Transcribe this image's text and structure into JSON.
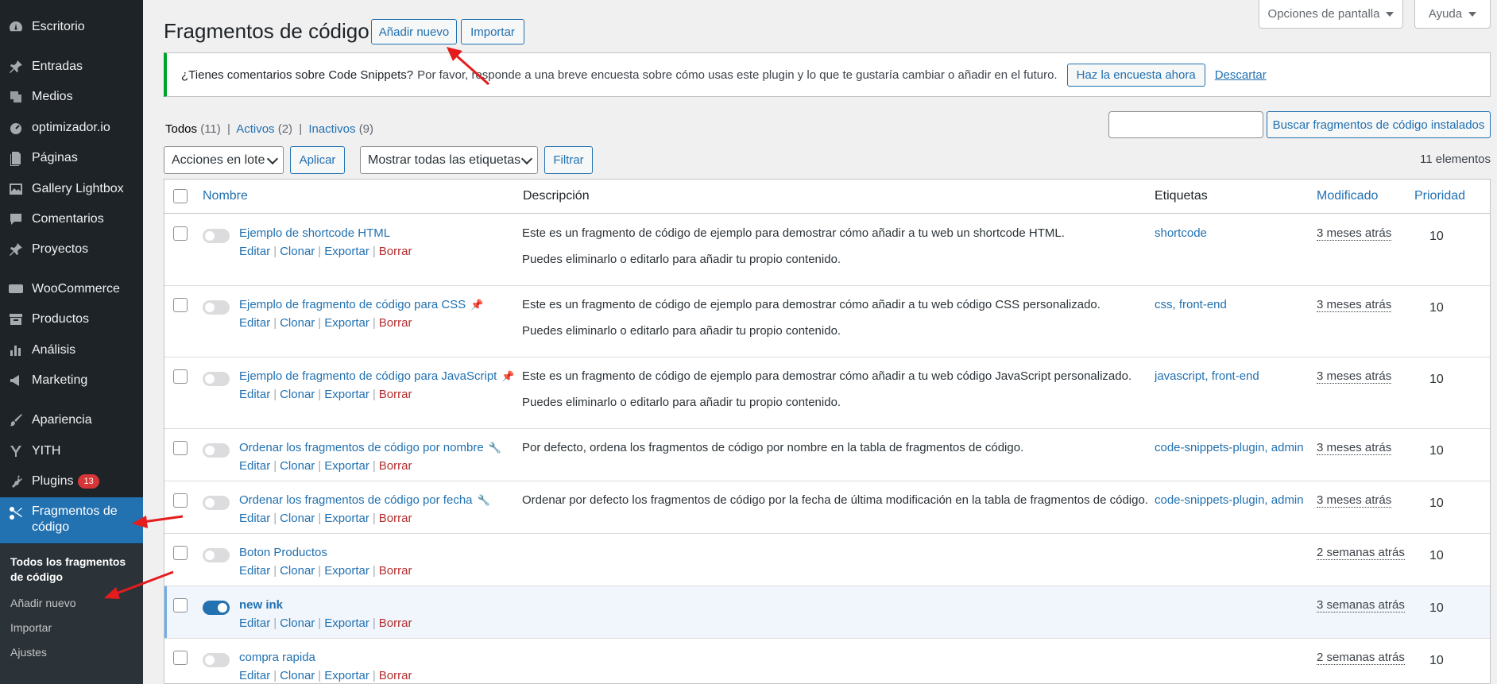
{
  "sidebar": {
    "items": [
      {
        "label": "Escritorio",
        "icon": "dashboard-icon"
      },
      {
        "label": "Entradas",
        "icon": "pin-icon"
      },
      {
        "label": "Medios",
        "icon": "media-icon"
      },
      {
        "label": "optimizador.io",
        "icon": "gauge-icon"
      },
      {
        "label": "Páginas",
        "icon": "page-icon"
      },
      {
        "label": "Gallery Lightbox",
        "icon": "gallery-icon"
      },
      {
        "label": "Comentarios",
        "icon": "comment-icon"
      },
      {
        "label": "Proyectos",
        "icon": "pin-icon"
      },
      {
        "label": "WooCommerce",
        "icon": "woo-icon"
      },
      {
        "label": "Productos",
        "icon": "archive-icon"
      },
      {
        "label": "Análisis",
        "icon": "bar-chart-icon"
      },
      {
        "label": "Marketing",
        "icon": "megaphone-icon"
      },
      {
        "label": "Apariencia",
        "icon": "brush-icon"
      },
      {
        "label": "YITH",
        "icon": "yith-icon"
      },
      {
        "label": "Plugins",
        "icon": "plugin-icon",
        "badge": "13"
      },
      {
        "label": "Fragmentos de código",
        "icon": "scissors-icon"
      }
    ],
    "submenu": [
      {
        "label": "Todos los fragmentos de código"
      },
      {
        "label": "Añadir nuevo"
      },
      {
        "label": "Importar"
      },
      {
        "label": "Ajustes"
      }
    ]
  },
  "header": {
    "title": "Fragmentos de código",
    "add_new": "Añadir nuevo",
    "import": "Importar",
    "screen_options": "Opciones de pantalla",
    "help": "Ayuda"
  },
  "notice": {
    "strong": "¿Tienes comentarios sobre Code Snippets?",
    "text": "Por favor, responde a una breve encuesta sobre cómo usas este plugin y lo que te gustaría cambiar o añadir en el futuro.",
    "survey_button": "Haz la encuesta ahora",
    "dismiss": "Descartar"
  },
  "filters": {
    "all": "Todos",
    "all_count": "(11)",
    "active": "Activos",
    "active_count": "(2)",
    "inactive": "Inactivos",
    "inactive_count": "(9)",
    "search_button": "Buscar fragmentos de código instalados",
    "bulk_actions": "Acciones en lote",
    "apply": "Aplicar",
    "tags_select": "Mostrar todas las etiquetas",
    "filter": "Filtrar",
    "item_count": "11 elementos"
  },
  "table": {
    "columns": {
      "name": "Nombre",
      "description": "Descripción",
      "tags": "Etiquetas",
      "modified": "Modificado",
      "priority": "Prioridad"
    },
    "actions": {
      "edit": "Editar",
      "clone": "Clonar",
      "export": "Exportar",
      "delete": "Borrar",
      "sep": "|"
    },
    "rows": [
      {
        "name": "Ejemplo de shortcode HTML",
        "desc1": "Este es un fragmento de código de ejemplo para demostrar cómo añadir a tu web un shortcode HTML.",
        "desc2": "Puedes eliminarlo o editarlo para añadir tu propio contenido.",
        "tags": "shortcode",
        "modified": "3 meses atrás",
        "priority": "10",
        "active": false
      },
      {
        "name": "Ejemplo de fragmento de código para CSS",
        "desc1": "Este es un fragmento de código de ejemplo para demostrar cómo añadir a tu web código CSS personalizado.",
        "desc2": "Puedes eliminarlo o editarlo para añadir tu propio contenido.",
        "tags": "css, front-end",
        "modified": "3 meses atrás",
        "priority": "10",
        "active": false
      },
      {
        "name": "Ejemplo de fragmento de código para JavaScript",
        "desc1": "Este es un fragmento de código de ejemplo para demostrar cómo añadir a tu web código JavaScript personalizado.",
        "desc2": "Puedes eliminarlo o editarlo para añadir tu propio contenido.",
        "tags": "javascript, front-end",
        "modified": "3 meses atrás",
        "priority": "10",
        "active": false
      },
      {
        "name": "Ordenar los fragmentos de código por nombre",
        "desc1": "Por defecto, ordena los fragmentos de código por nombre en la tabla de fragmentos de código.",
        "desc2": "",
        "tags": "code-snippets-plugin, admin",
        "modified": "3 meses atrás",
        "priority": "10",
        "active": false
      },
      {
        "name": "Ordenar los fragmentos de código por fecha",
        "desc1": "Ordenar por defecto los fragmentos de código por la fecha de última modificación en la tabla de fragmentos de código.",
        "desc2": "",
        "tags": "code-snippets-plugin, admin",
        "modified": "3 meses atrás",
        "priority": "10",
        "active": false
      },
      {
        "name": "Boton Productos",
        "desc1": "",
        "desc2": "",
        "tags": "",
        "modified": "2 semanas atrás",
        "priority": "10",
        "active": false
      },
      {
        "name": "new ink",
        "desc1": "",
        "desc2": "",
        "tags": "",
        "modified": "3 semanas atrás",
        "priority": "10",
        "active": true
      },
      {
        "name": "compra rapida",
        "desc1": "",
        "desc2": "",
        "tags": "",
        "modified": "2 semanas atrás",
        "priority": "10",
        "active": false
      }
    ]
  },
  "colors": {
    "sidebar_bg": "#1d2327",
    "accent": "#2271b1",
    "notice_border": "#00a32a",
    "delete": "#b32d2e",
    "badge": "#d63638",
    "annotation_arrow": "#e51c1c"
  }
}
